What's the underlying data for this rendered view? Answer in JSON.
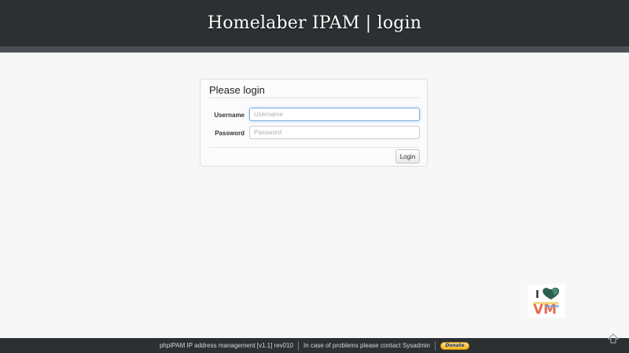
{
  "header": {
    "title": "Homelaber IPAM | login"
  },
  "login": {
    "title": "Please login",
    "username_label": "Username",
    "username_placeholder": "Username",
    "username_value": "",
    "password_label": "Password",
    "password_placeholder": "Password",
    "password_value": "",
    "submit_label": "Login"
  },
  "badge": {
    "icon": "i-love-vm-logo",
    "text_i": "I",
    "text_vm": "VM"
  },
  "footer": {
    "version_text": "phpIPAM IP address management [v1.1] rev010",
    "contact_text": "In case of problems please contact Sysadmin",
    "donate_label": "Donate"
  },
  "icons": {
    "scroll_top": "scroll-to-top-icon"
  },
  "colors": {
    "header_bg": "#2d3032",
    "page_bg": "#f7f7f7",
    "focus_border": "#7fb3e0",
    "donate_bg": "#f5b31d"
  }
}
